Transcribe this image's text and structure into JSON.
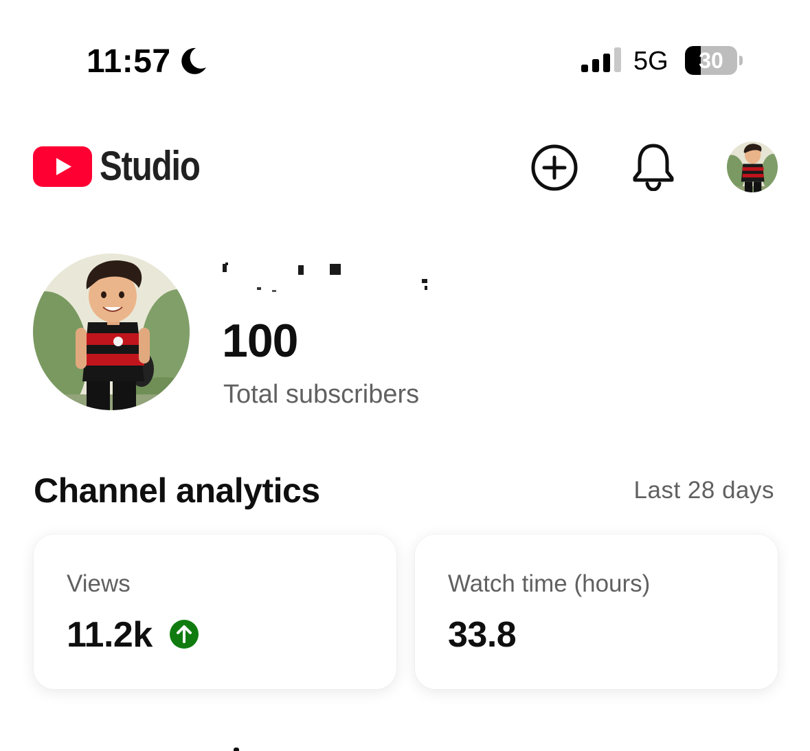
{
  "status_bar": {
    "time": "11:57",
    "focus_icon": "moon-icon",
    "signal_icon": "signal-bars-icon",
    "signal_bars_active": 3,
    "signal_bars_total": 4,
    "network": "5G",
    "battery_percent": "30",
    "battery_level": 0.3
  },
  "header": {
    "logo_icon": "youtube-play-icon",
    "app_name": "Studio",
    "create_icon": "add-circle-icon",
    "notifications_icon": "bell-icon",
    "account_icon": "avatar"
  },
  "channel": {
    "name_redacted": true,
    "subscriber_count": "100",
    "subscriber_label": "Total subscribers"
  },
  "analytics": {
    "title": "Channel analytics",
    "period": "Last 28 days",
    "metrics": [
      {
        "label": "Views",
        "value": "11.2k",
        "trend": "up",
        "trend_icon": "arrow-up-circle-icon"
      },
      {
        "label": "Watch time (hours)",
        "value": "33.8"
      }
    ]
  },
  "colors": {
    "youtube_red": "#FF0033",
    "text_primary": "#0F0F0F",
    "text_secondary": "#606060",
    "trend_green": "#107C10"
  }
}
